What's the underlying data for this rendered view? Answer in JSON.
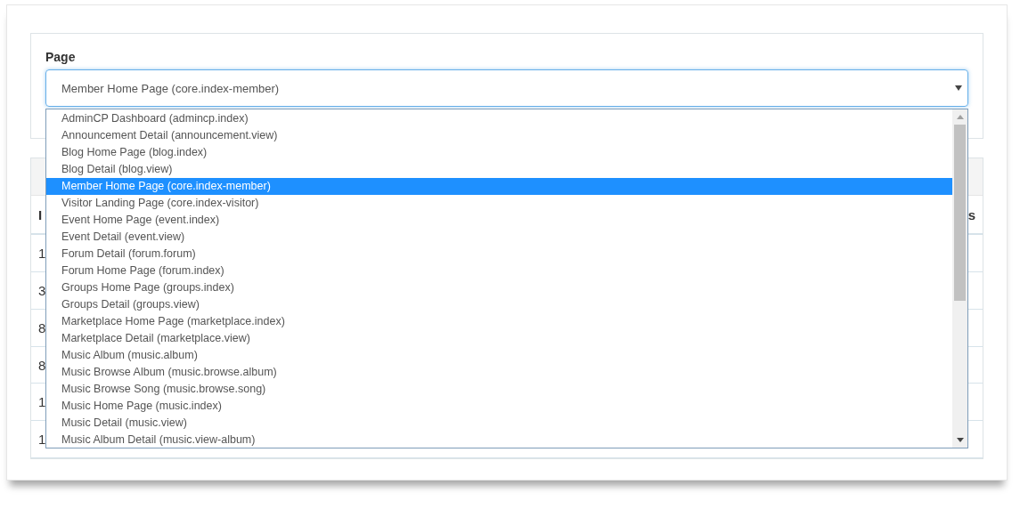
{
  "form": {
    "label": "Page",
    "select": {
      "value": "Member Home Page (core.index-member)",
      "expanded": true
    }
  },
  "dropdown": {
    "options": [
      {
        "label": "AdminCP Dashboard (admincp.index)",
        "selected": false
      },
      {
        "label": "Announcement Detail (announcement.view)",
        "selected": false
      },
      {
        "label": "Blog Home Page (blog.index)",
        "selected": false
      },
      {
        "label": "Blog Detail (blog.view)",
        "selected": false
      },
      {
        "label": "Member Home Page (core.index-member)",
        "selected": true
      },
      {
        "label": "Visitor Landing Page (core.index-visitor)",
        "selected": false
      },
      {
        "label": "Event Home Page (event.index)",
        "selected": false
      },
      {
        "label": "Event Detail (event.view)",
        "selected": false
      },
      {
        "label": "Forum Detail (forum.forum)",
        "selected": false
      },
      {
        "label": "Forum Home Page (forum.index)",
        "selected": false
      },
      {
        "label": "Groups Home Page (groups.index)",
        "selected": false
      },
      {
        "label": "Groups Detail (groups.view)",
        "selected": false
      },
      {
        "label": "Marketplace Home Page (marketplace.index)",
        "selected": false
      },
      {
        "label": "Marketplace Detail (marketplace.view)",
        "selected": false
      },
      {
        "label": "Music Album (music.album)",
        "selected": false
      },
      {
        "label": "Music Browse Album (music.browse.album)",
        "selected": false
      },
      {
        "label": "Music Browse Song (music.browse.song)",
        "selected": false
      },
      {
        "label": "Music Home Page (music.index)",
        "selected": false
      },
      {
        "label": "Music Detail (music.view)",
        "selected": false
      },
      {
        "label": "Music Album Detail (music.view-album)",
        "selected": false
      }
    ]
  },
  "table": {
    "columns": [
      "I",
      "s"
    ],
    "rows": [
      [
        "1"
      ],
      [
        "3"
      ],
      [
        "8"
      ],
      [
        "8"
      ],
      [
        "1"
      ],
      [
        "1"
      ]
    ]
  }
}
